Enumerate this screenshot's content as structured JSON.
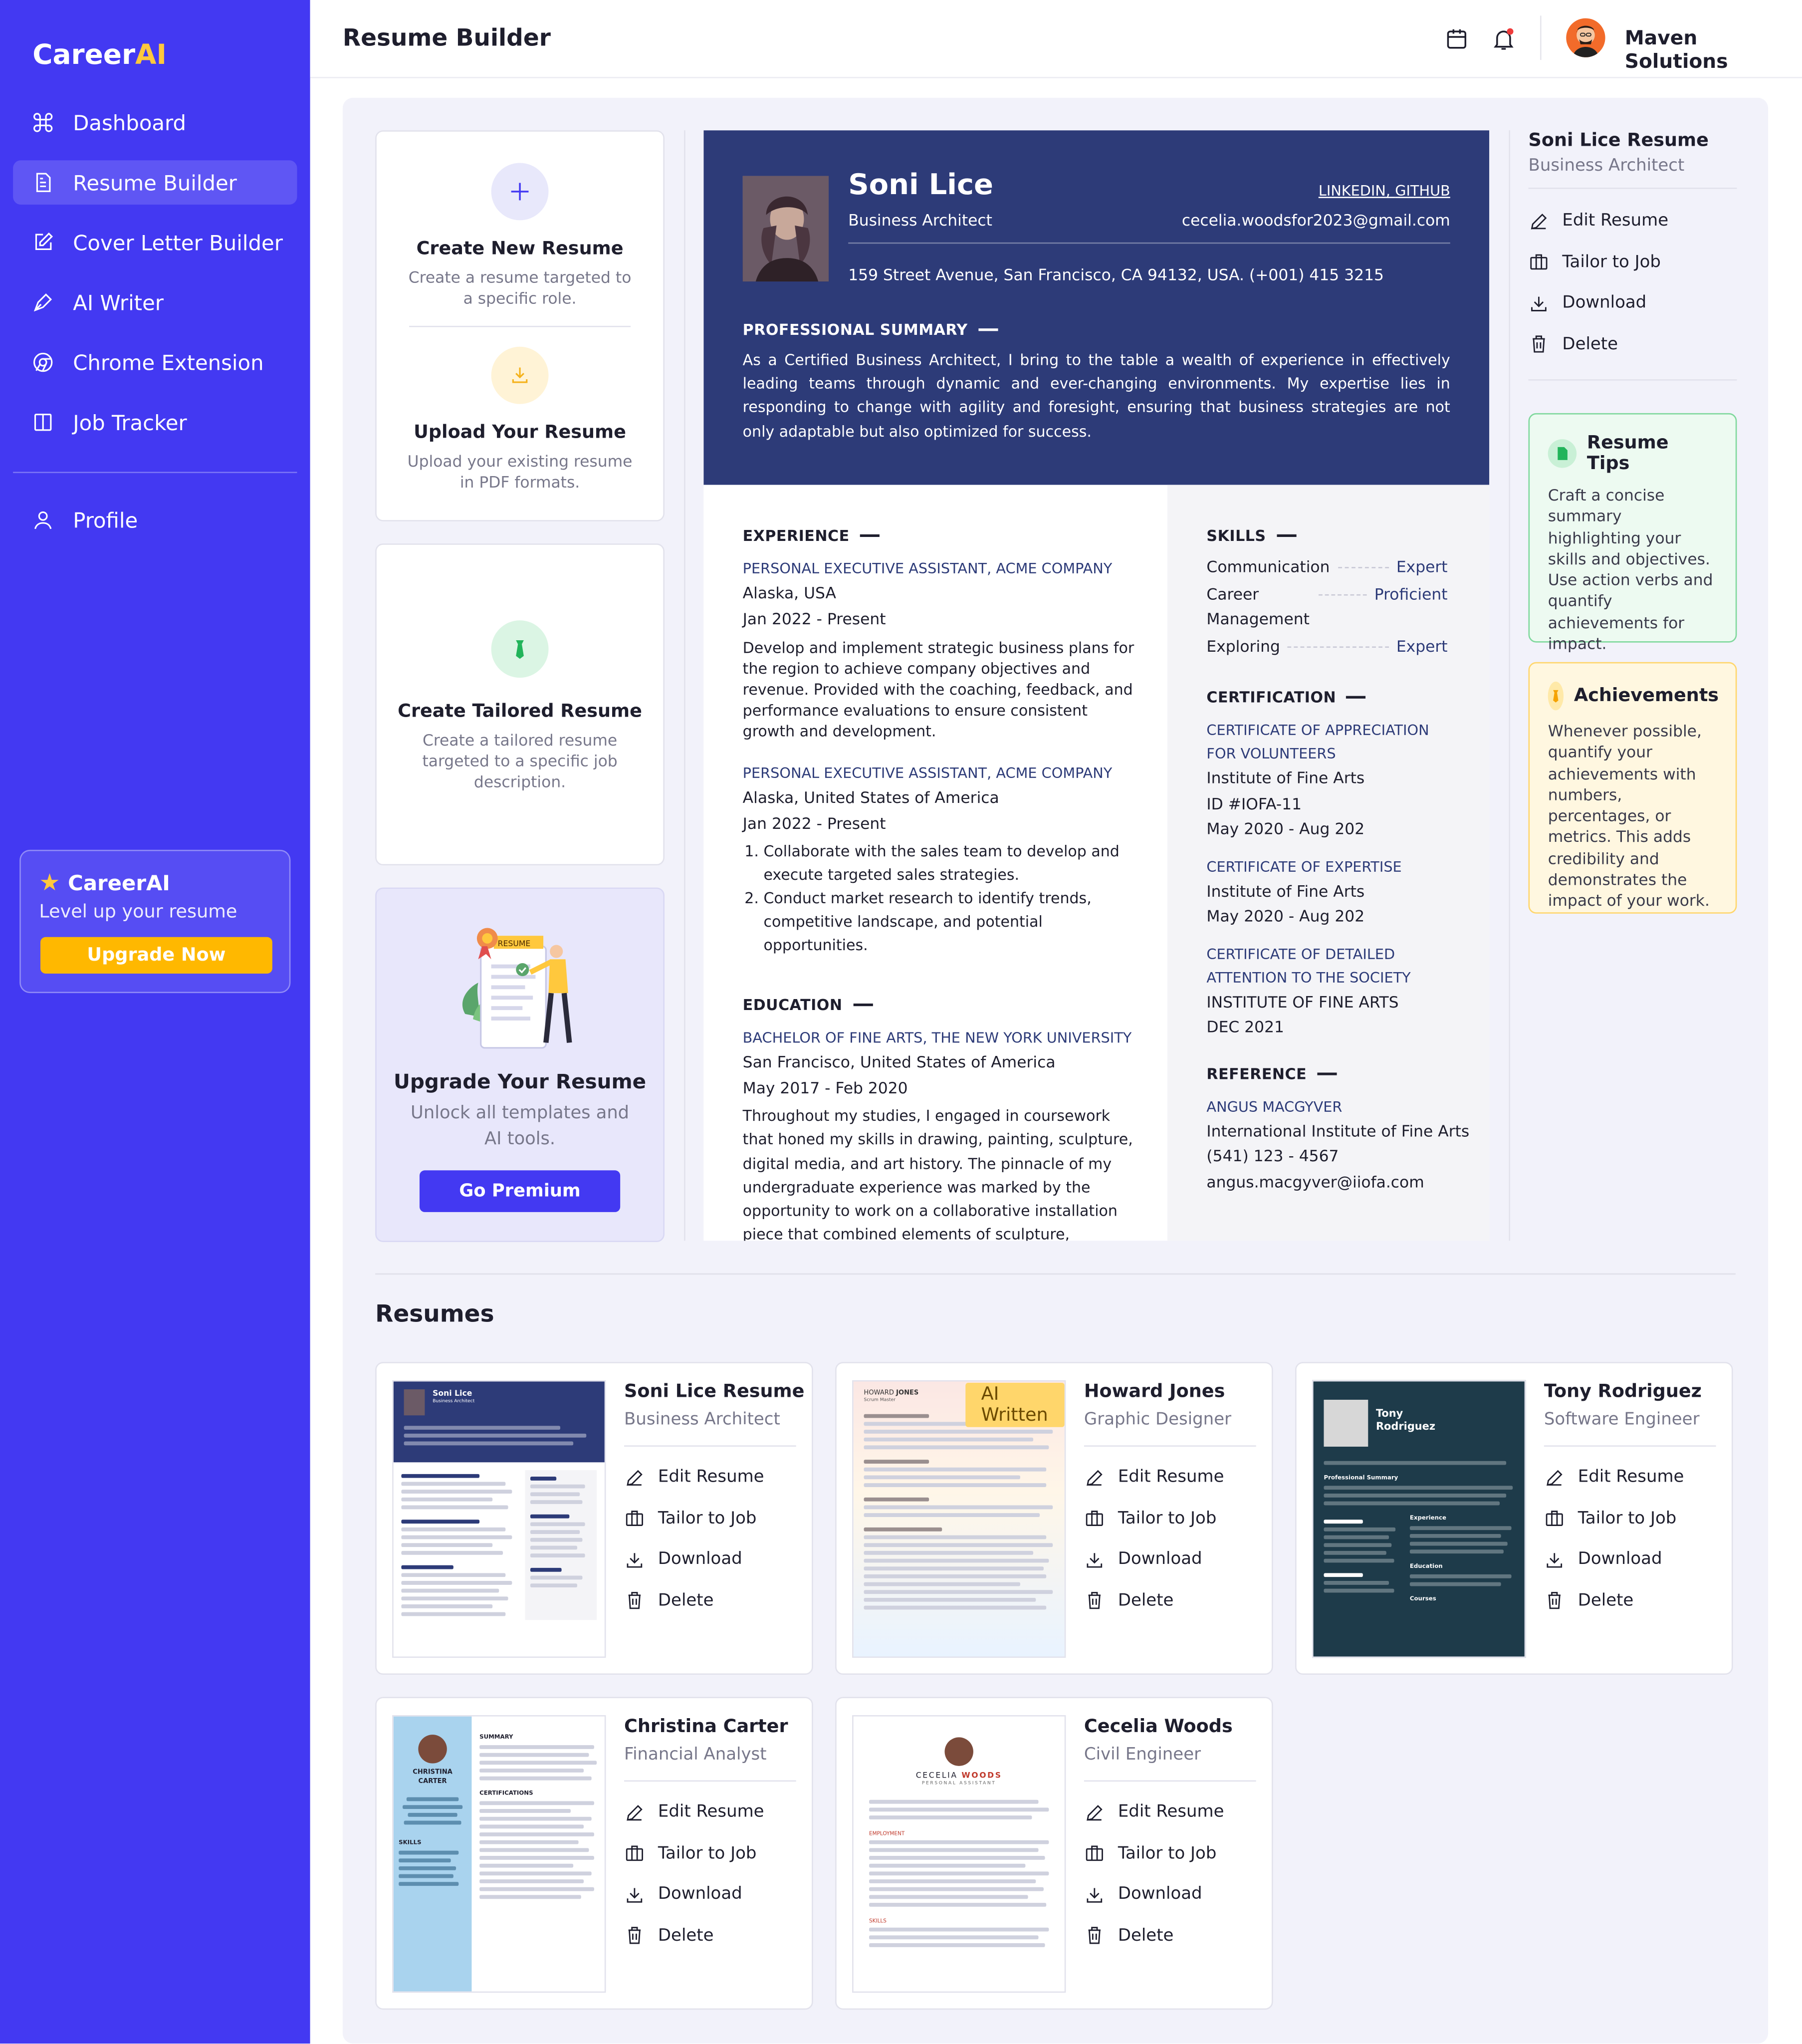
{
  "brand": {
    "name_main": "Career",
    "name_accent": "AI",
    "accent_color": "#ffc83d",
    "primary_color": "#4339f2"
  },
  "sidebar": {
    "items": [
      {
        "label": "Dashboard",
        "icon": "command-icon"
      },
      {
        "label": "Resume Builder",
        "icon": "document-icon"
      },
      {
        "label": "Cover Letter Builder",
        "icon": "edit-icon"
      },
      {
        "label": "AI Writer",
        "icon": "pen-icon"
      },
      {
        "label": "Chrome Extension",
        "icon": "chrome-icon"
      },
      {
        "label": "Job Tracker",
        "icon": "columns-icon"
      }
    ],
    "profile_label": "Profile",
    "promo": {
      "title": "CareerAI",
      "subtitle": "Level up your resume",
      "button": "Upgrade Now"
    }
  },
  "header": {
    "title": "Resume Builder",
    "user_name": "Maven Solutions"
  },
  "options": {
    "create": {
      "title": "Create New Resume",
      "desc": "Create a resume targeted to a specific role."
    },
    "upload": {
      "title": "Upload Your Resume",
      "desc": "Upload your existing resume in PDF formats."
    },
    "tailored": {
      "title": "Create Tailored Resume",
      "desc": "Create a tailored resume targeted to a specific job description."
    },
    "upgrade": {
      "title": "Upgrade Your Resume",
      "desc": "Unlock all templates and AI tools.",
      "button": "Go Premium",
      "badge": "RESUME"
    }
  },
  "preview": {
    "name": "Soni Lice",
    "job": "Business Architect",
    "link_linkedin": "LINKEDIN",
    "link_github": "GITHUB",
    "email": "cecelia.woodsfor2023@gmail.com",
    "address": "159 Street Avenue, San Francisco, CA 94132, USA. (+001) 415 3215",
    "summary_title": "PROFESSIONAL SUMMARY",
    "summary": "As a Certified Business Architect, I bring to the table a wealth of experience in effectively leading teams through dynamic and ever-changing environments. My expertise lies in responding to change with agility and foresight, ensuring that business strategies are not only adaptable but also optimized for success.",
    "experience_title": "EXPERIENCE",
    "exp1": {
      "role": "PERSONAL EXECUTIVE ASSISTANT, ACME COMPANY",
      "location": "Alaska, USA",
      "dates": "Jan 2022 - Present",
      "desc": "Develop and implement strategic business plans for the region to achieve company objectives and revenue. Provided with the coaching, feedback, and performance evaluations to ensure consistent growth and development."
    },
    "exp2": {
      "role": "PERSONAL EXECUTIVE ASSISTANT, ACME COMPANY",
      "location": "Alaska, United States of America",
      "dates": "Jan 2022 - Present",
      "b1": "Collaborate with the sales team to develop and execute targeted sales strategies.",
      "b2": "Conduct market research to identify trends, competitive landscape, and potential opportunities."
    },
    "education_title": "EDUCATION",
    "edu": {
      "degree": "BACHELOR OF FINE ARTS, THE NEW YORK UNIVERSITY",
      "location": "San Francisco, United States of America",
      "dates": "May 2017 - Feb 2020",
      "desc": "Throughout my studies, I engaged in coursework that honed my skills in drawing, painting, sculpture, digital media, and art history. The pinnacle of my undergraduate experience was marked by the opportunity to work on a collaborative installation piece that combined elements of sculpture, interactive digital media. Additionally, I delved deep into art history, uncovering the rich tapestry"
    },
    "skills_title": "SKILLS",
    "skills": [
      {
        "name": "Communication",
        "level": "Expert"
      },
      {
        "name": "Career Management",
        "level": "Proficient"
      },
      {
        "name": "Exploring",
        "level": "Expert"
      }
    ],
    "cert_title": "CERTIFICATION",
    "cert1": {
      "name": "CERTIFICATE OF APPRECIATION FOR VOLUNTEERS",
      "org": "Institute of Fine Arts",
      "id": "ID #IOFA-11",
      "dates": "May 2020 - Aug 202"
    },
    "cert2": {
      "name": "CERTIFICATE OF EXPERTISE",
      "org": "Institute of Fine Arts",
      "dates": "May 2020 - Aug 202"
    },
    "cert3": {
      "name": "CERTIFICATE OF DETAILED ATTENTION TO THE SOCIETY",
      "org": "INSTITUTE OF FINE ARTS",
      "dates": "DEC 2021"
    },
    "ref_title": "REFERENCE",
    "ref": {
      "name": "ANGUS MACGYVER",
      "org": "International Institute of Fine Arts",
      "phone": "(541) 123 - 4567",
      "email": "angus.macgyver@iiofa.com"
    }
  },
  "side": {
    "title": "Soni Lice Resume",
    "subtitle": "Business Architect",
    "actions": [
      "Edit Resume",
      "Tailor to Job",
      "Download",
      "Delete"
    ],
    "tips": {
      "title": "Resume Tips",
      "body": "Craft a concise summary highlighting your skills and objectives. Use action verbs and quantify achievements for impact."
    },
    "achievements": {
      "title": "Achievements",
      "body": "Whenever possible, quantify your achievements with numbers, percentages, or metrics. This adds credibility and demonstrates the impact of your work."
    }
  },
  "resumes_heading": "Resumes",
  "resume_cards": [
    {
      "name": "Soni Lice Resume",
      "role": "Business Architect",
      "thumb_name": "Soni Lice",
      "thumb_job": "Business Architect"
    },
    {
      "name": "Howard Jones",
      "role": "Graphic Designer",
      "badge": "AI Written",
      "thumb_first": "HOWARD",
      "thumb_last": "JONES",
      "thumb_job": "Scrum Master"
    },
    {
      "name": "Tony Rodriguez",
      "role": "Software Engineer",
      "thumb_first": "Tony",
      "thumb_last": "Rodriguez",
      "thumb_section": "Professional Summary",
      "thumb_exp": "Experience",
      "thumb_edu": "Education",
      "thumb_courses": "Courses"
    },
    {
      "name": "Christina Carter",
      "role": "Financial Analyst",
      "thumb_first": "CHRISTINA",
      "thumb_last": "CARTER",
      "thumb_summary": "SUMMARY",
      "thumb_cert": "CERTIFICATIONS",
      "thumb_skills": "SKILLS"
    },
    {
      "name": "Cecelia Woods",
      "role": "Civil Engineer",
      "thumb_first": "CECELIA",
      "thumb_last": "WOODS",
      "thumb_job": "PERSONAL ASSISTANT",
      "thumb_exp": "EMPLOYMENT",
      "thumb_skills": "SKILLS"
    }
  ],
  "card_actions": [
    "Edit Resume",
    "Tailor to Job",
    "Download",
    "Delete"
  ]
}
